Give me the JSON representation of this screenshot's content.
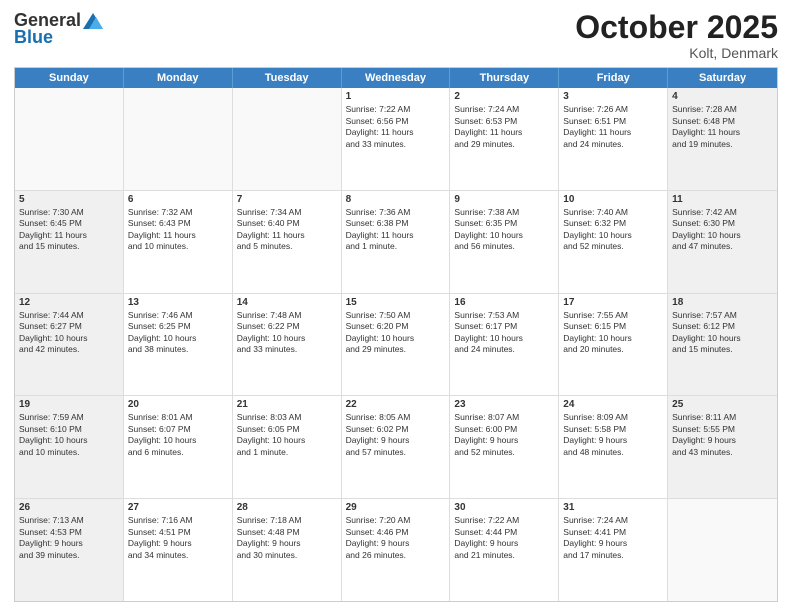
{
  "header": {
    "logo_general": "General",
    "logo_blue": "Blue",
    "month": "October 2025",
    "location": "Kolt, Denmark"
  },
  "days_of_week": [
    "Sunday",
    "Monday",
    "Tuesday",
    "Wednesday",
    "Thursday",
    "Friday",
    "Saturday"
  ],
  "weeks": [
    [
      {
        "day": "",
        "info": "",
        "empty": true
      },
      {
        "day": "",
        "info": "",
        "empty": true
      },
      {
        "day": "",
        "info": "",
        "empty": true
      },
      {
        "day": "1",
        "info": "Sunrise: 7:22 AM\nSunset: 6:56 PM\nDaylight: 11 hours\nand 33 minutes.",
        "empty": false
      },
      {
        "day": "2",
        "info": "Sunrise: 7:24 AM\nSunset: 6:53 PM\nDaylight: 11 hours\nand 29 minutes.",
        "empty": false
      },
      {
        "day": "3",
        "info": "Sunrise: 7:26 AM\nSunset: 6:51 PM\nDaylight: 11 hours\nand 24 minutes.",
        "empty": false
      },
      {
        "day": "4",
        "info": "Sunrise: 7:28 AM\nSunset: 6:48 PM\nDaylight: 11 hours\nand 19 minutes.",
        "empty": false,
        "shaded": true
      }
    ],
    [
      {
        "day": "5",
        "info": "Sunrise: 7:30 AM\nSunset: 6:45 PM\nDaylight: 11 hours\nand 15 minutes.",
        "empty": false,
        "shaded": true
      },
      {
        "day": "6",
        "info": "Sunrise: 7:32 AM\nSunset: 6:43 PM\nDaylight: 11 hours\nand 10 minutes.",
        "empty": false
      },
      {
        "day": "7",
        "info": "Sunrise: 7:34 AM\nSunset: 6:40 PM\nDaylight: 11 hours\nand 5 minutes.",
        "empty": false
      },
      {
        "day": "8",
        "info": "Sunrise: 7:36 AM\nSunset: 6:38 PM\nDaylight: 11 hours\nand 1 minute.",
        "empty": false
      },
      {
        "day": "9",
        "info": "Sunrise: 7:38 AM\nSunset: 6:35 PM\nDaylight: 10 hours\nand 56 minutes.",
        "empty": false
      },
      {
        "day": "10",
        "info": "Sunrise: 7:40 AM\nSunset: 6:32 PM\nDaylight: 10 hours\nand 52 minutes.",
        "empty": false
      },
      {
        "day": "11",
        "info": "Sunrise: 7:42 AM\nSunset: 6:30 PM\nDaylight: 10 hours\nand 47 minutes.",
        "empty": false,
        "shaded": true
      }
    ],
    [
      {
        "day": "12",
        "info": "Sunrise: 7:44 AM\nSunset: 6:27 PM\nDaylight: 10 hours\nand 42 minutes.",
        "empty": false,
        "shaded": true
      },
      {
        "day": "13",
        "info": "Sunrise: 7:46 AM\nSunset: 6:25 PM\nDaylight: 10 hours\nand 38 minutes.",
        "empty": false
      },
      {
        "day": "14",
        "info": "Sunrise: 7:48 AM\nSunset: 6:22 PM\nDaylight: 10 hours\nand 33 minutes.",
        "empty": false
      },
      {
        "day": "15",
        "info": "Sunrise: 7:50 AM\nSunset: 6:20 PM\nDaylight: 10 hours\nand 29 minutes.",
        "empty": false
      },
      {
        "day": "16",
        "info": "Sunrise: 7:53 AM\nSunset: 6:17 PM\nDaylight: 10 hours\nand 24 minutes.",
        "empty": false
      },
      {
        "day": "17",
        "info": "Sunrise: 7:55 AM\nSunset: 6:15 PM\nDaylight: 10 hours\nand 20 minutes.",
        "empty": false
      },
      {
        "day": "18",
        "info": "Sunrise: 7:57 AM\nSunset: 6:12 PM\nDaylight: 10 hours\nand 15 minutes.",
        "empty": false,
        "shaded": true
      }
    ],
    [
      {
        "day": "19",
        "info": "Sunrise: 7:59 AM\nSunset: 6:10 PM\nDaylight: 10 hours\nand 10 minutes.",
        "empty": false,
        "shaded": true
      },
      {
        "day": "20",
        "info": "Sunrise: 8:01 AM\nSunset: 6:07 PM\nDaylight: 10 hours\nand 6 minutes.",
        "empty": false
      },
      {
        "day": "21",
        "info": "Sunrise: 8:03 AM\nSunset: 6:05 PM\nDaylight: 10 hours\nand 1 minute.",
        "empty": false
      },
      {
        "day": "22",
        "info": "Sunrise: 8:05 AM\nSunset: 6:02 PM\nDaylight: 9 hours\nand 57 minutes.",
        "empty": false
      },
      {
        "day": "23",
        "info": "Sunrise: 8:07 AM\nSunset: 6:00 PM\nDaylight: 9 hours\nand 52 minutes.",
        "empty": false
      },
      {
        "day": "24",
        "info": "Sunrise: 8:09 AM\nSunset: 5:58 PM\nDaylight: 9 hours\nand 48 minutes.",
        "empty": false
      },
      {
        "day": "25",
        "info": "Sunrise: 8:11 AM\nSunset: 5:55 PM\nDaylight: 9 hours\nand 43 minutes.",
        "empty": false,
        "shaded": true
      }
    ],
    [
      {
        "day": "26",
        "info": "Sunrise: 7:13 AM\nSunset: 4:53 PM\nDaylight: 9 hours\nand 39 minutes.",
        "empty": false,
        "shaded": true
      },
      {
        "day": "27",
        "info": "Sunrise: 7:16 AM\nSunset: 4:51 PM\nDaylight: 9 hours\nand 34 minutes.",
        "empty": false
      },
      {
        "day": "28",
        "info": "Sunrise: 7:18 AM\nSunset: 4:48 PM\nDaylight: 9 hours\nand 30 minutes.",
        "empty": false
      },
      {
        "day": "29",
        "info": "Sunrise: 7:20 AM\nSunset: 4:46 PM\nDaylight: 9 hours\nand 26 minutes.",
        "empty": false
      },
      {
        "day": "30",
        "info": "Sunrise: 7:22 AM\nSunset: 4:44 PM\nDaylight: 9 hours\nand 21 minutes.",
        "empty": false
      },
      {
        "day": "31",
        "info": "Sunrise: 7:24 AM\nSunset: 4:41 PM\nDaylight: 9 hours\nand 17 minutes.",
        "empty": false
      },
      {
        "day": "",
        "info": "",
        "empty": true,
        "shaded": true
      }
    ]
  ]
}
